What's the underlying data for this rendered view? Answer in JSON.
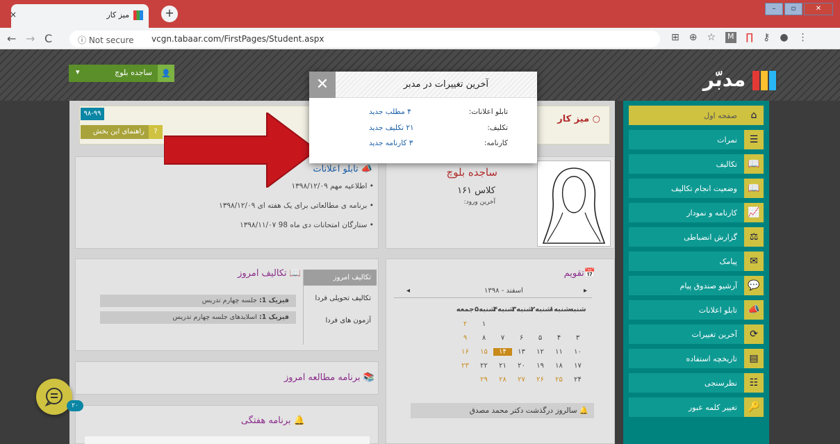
{
  "browser": {
    "tab_title": "میز کار",
    "tab_close": "×",
    "new_tab": "+",
    "security": "ⓘ Not secure",
    "url": "vcgn.tabaar.com/FirstPages/Student.aspx",
    "win_min": "–",
    "win_max": "▫",
    "win_close": "✕"
  },
  "header": {
    "logo_text": "مدبّر",
    "user_name": "ساجده بلوچ"
  },
  "sidebar": {
    "items": [
      {
        "label": "صفحه اول",
        "icon": "home-icon",
        "glyph": "⌂"
      },
      {
        "label": "نمرات",
        "icon": "list-icon",
        "glyph": "☰"
      },
      {
        "label": "تکالیف",
        "icon": "book-icon",
        "glyph": "📖"
      },
      {
        "label": "وضعیت انجام تکالیف",
        "icon": "book-open-icon",
        "glyph": "📖"
      },
      {
        "label": "کارنامه و نمودار",
        "icon": "chart-icon",
        "glyph": "📈"
      },
      {
        "label": "گزارش انضباطی",
        "icon": "discipline-icon",
        "glyph": "⚖"
      },
      {
        "label": "پیامک",
        "icon": "envelope-icon",
        "glyph": "✉"
      },
      {
        "label": "آرشیو صندوق پیام",
        "icon": "chat-icon",
        "glyph": "💬"
      },
      {
        "label": "تابلو اعلانات",
        "icon": "megaphone-icon",
        "glyph": "📣"
      },
      {
        "label": "آخرین تغییرات",
        "icon": "refresh-icon",
        "glyph": "⟳"
      },
      {
        "label": "تاریخچه استفاده",
        "icon": "history-icon",
        "glyph": "▤"
      },
      {
        "label": "نظرسنجی",
        "icon": "survey-icon",
        "glyph": "☷"
      },
      {
        "label": "تغییر کلمه عبور",
        "icon": "key-icon",
        "glyph": "🔑"
      }
    ]
  },
  "desk": {
    "title": "میز کار",
    "year_badge": "۹۸-۹۹",
    "help_label": "راهنمای این بخش",
    "help_q": "?"
  },
  "profile": {
    "name": "ساجده بلوچ",
    "class": "کلاس ۱۶۱",
    "last_login": "آخرین ورود:"
  },
  "announcements": {
    "title": "تابلو اعلانات",
    "items": [
      "اطلاعیه مهم ۱۳۹۸/۱۲/۰۹",
      "برنامه ی مطالعاتی برای یک هفته ای ۱۳۹۸/۱۲/۰۹",
      "ستارگان امتحانات دی ماه 98 ۱۳۹۸/۱۱/۰۷"
    ]
  },
  "calendar": {
    "title": "تقویم",
    "month": "اسفند - ۱۳۹۸",
    "prev": "◂",
    "next": "▸",
    "weekdays": [
      "شنبه",
      "۱شنبه",
      "۲شنبه",
      "۳شنبه",
      "۴شنبه",
      "۵شنبه",
      "جمعه"
    ],
    "weeks": [
      [
        "",
        "",
        "",
        "",
        "",
        "۱",
        "۲"
      ],
      [
        "۳",
        "۴",
        "۵",
        "۶",
        "۷",
        "۸",
        "۹"
      ],
      [
        "۱۰",
        "۱۱",
        "۱۲",
        "۱۳",
        "۱۴",
        "۱۵",
        "۱۶"
      ],
      [
        "۱۷",
        "۱۸",
        "۱۹",
        "۲۰",
        "۲۱",
        "۲۲",
        "۲۳"
      ],
      [
        "۲۴",
        "۲۵",
        "۲۶",
        "۲۷",
        "۲۸",
        "۲۹",
        ""
      ]
    ],
    "event": "سالروز درگذشت دکتر محمد مصدق"
  },
  "homework": {
    "title": "تکالیف امروز",
    "tabs": [
      "تکالیف امروز",
      "تکالیف تحویلی فردا",
      "آزمون های فردا"
    ],
    "rows": [
      {
        "subject": "فیزیک 1:",
        "text": "جلسه چهارم تدریس"
      },
      {
        "subject": "فیزیک 1:",
        "text": "اسلایدهای جلسه چهارم تدریس"
      }
    ]
  },
  "study_plan": {
    "title": "برنامه مطالعه امروز"
  },
  "weekly_plan": {
    "title": "برنامه هفتگی"
  },
  "modal": {
    "title": "آخرین تغییرات در مدبر",
    "close": "✕",
    "rows": [
      {
        "key": "تابلو اعلانات:",
        "value": "۴ مطلب جدید"
      },
      {
        "key": "تکلیف:",
        "value": "۲۱ تکلیف جدید"
      },
      {
        "key": "کارنامه:",
        "value": "۳ کارنامه جدید"
      }
    ]
  },
  "chat": {
    "badge": "۲۰"
  },
  "colors": {
    "accent": "#cfc240",
    "sidebar": "#00837f",
    "arrow": "#c8161d"
  }
}
